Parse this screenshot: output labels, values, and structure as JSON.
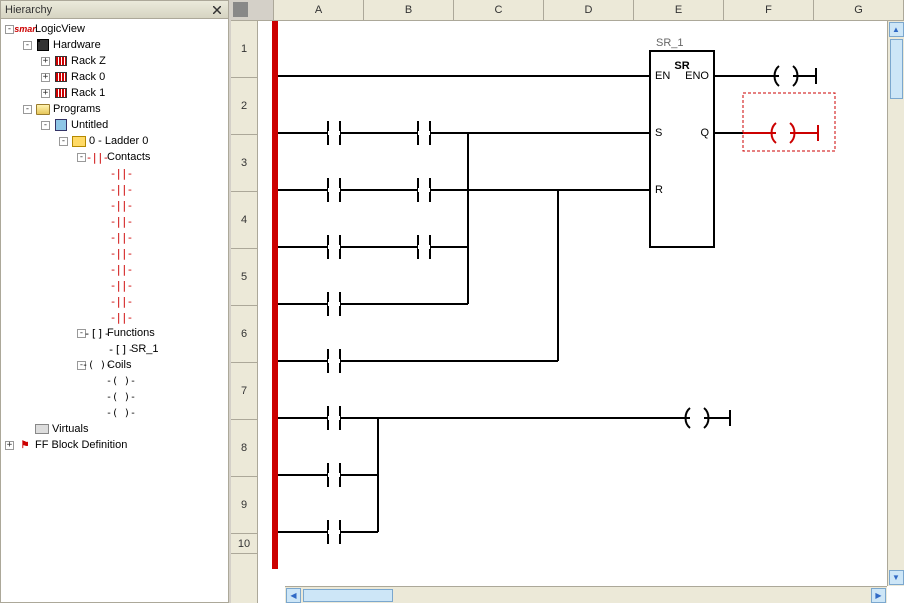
{
  "panel": {
    "title": "Hierarchy"
  },
  "tree": {
    "root": "LogicView",
    "hardware": "Hardware",
    "racks": [
      "Rack Z",
      "Rack 0",
      "Rack 1"
    ],
    "programs": "Programs",
    "untitled": "Untitled",
    "ladder0": "0 - Ladder 0",
    "contacts": "Contacts",
    "functions": "Functions",
    "sr1": "SR_1",
    "coils": "Coils",
    "virtuals": "Virtuals",
    "ffblock": "FF Block Definition"
  },
  "grid": {
    "columns": [
      "A",
      "B",
      "C",
      "D",
      "E",
      "F",
      "G"
    ],
    "rows": [
      "1",
      "2",
      "3",
      "4",
      "5",
      "6",
      "7",
      "8",
      "9",
      "10"
    ],
    "function_block": {
      "instance": "SR_1",
      "type": "SR",
      "pins_left": [
        "EN",
        "S",
        "R"
      ],
      "pins_right": [
        "ENO",
        "Q"
      ]
    }
  }
}
